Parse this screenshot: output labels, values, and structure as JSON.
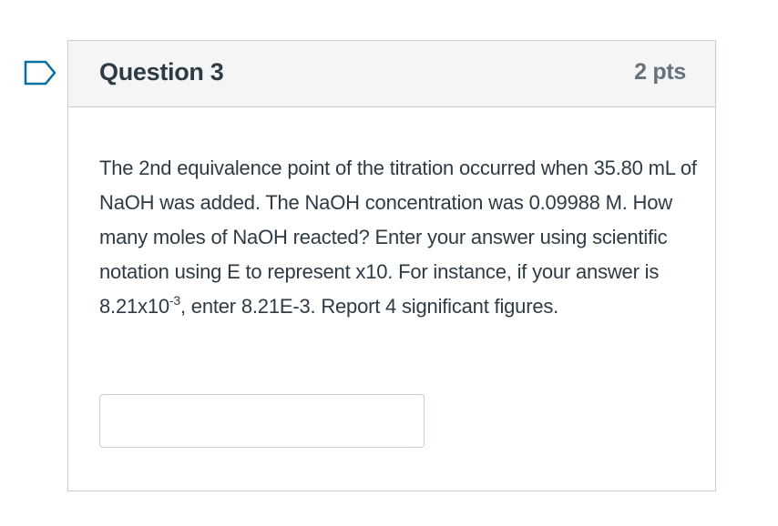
{
  "question": {
    "title": "Question 3",
    "points": "2 pts",
    "text_part1": "The 2nd equivalence point of the titration occurred when 35.80 mL of NaOH was added. The NaOH concentration was 0.09988 M. How many moles of NaOH reacted? Enter your answer using scientific notation using E to represent x10. For instance, if your answer is 8.21x10",
    "exponent": "-3",
    "text_part2": ", enter 8.21E-3. Report 4 significant figures.",
    "answer_value": "",
    "answer_placeholder": ""
  },
  "flag": {
    "icon": "flag-question-icon",
    "color": "#0770a3"
  },
  "colors": {
    "header_bg": "#f5f5f5",
    "border": "#c7cdd1",
    "text": "#2d3b45",
    "points_text": "#66737c"
  }
}
